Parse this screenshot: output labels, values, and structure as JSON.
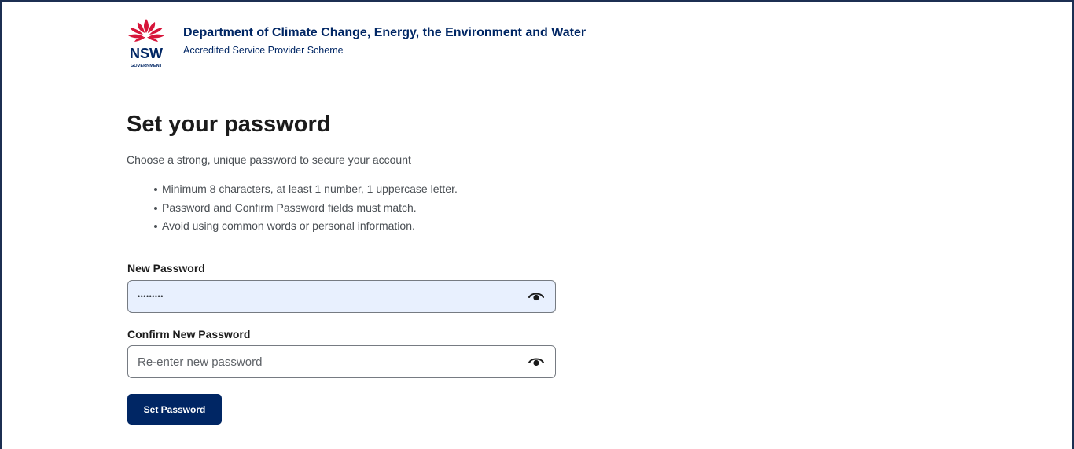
{
  "header": {
    "logo_text": "NSW",
    "logo_subtext": "GOVERNMENT",
    "department": "Department of Climate Change, Energy, the Environment and Water",
    "scheme": "Accredited Service Provider Scheme"
  },
  "page": {
    "title": "Set your password",
    "intro": "Choose a strong, unique password to secure your account",
    "rules": [
      "Minimum 8 characters, at least 1 number, 1 uppercase letter.",
      "Password and Confirm Password fields must match.",
      "Avoid using common words or personal information."
    ]
  },
  "form": {
    "new_password": {
      "label": "New Password",
      "value": "•••••••••",
      "placeholder": "",
      "toggle_icon": "eye-icon"
    },
    "confirm_password": {
      "label": "Confirm New Password",
      "value": "",
      "placeholder": "Re-enter new password",
      "toggle_icon": "eye-icon"
    },
    "submit_label": "Set Password"
  },
  "colors": {
    "brand_navy": "#002664",
    "waratah_red": "#d7153a",
    "autofill_bg": "#e8f0fe"
  }
}
